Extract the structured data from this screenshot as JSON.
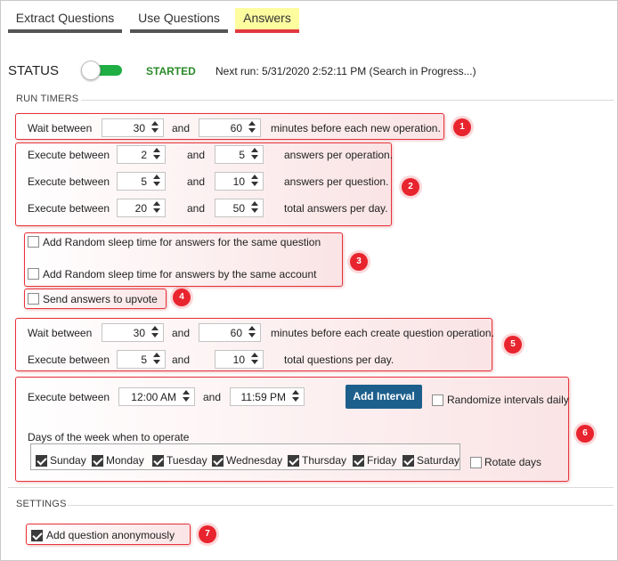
{
  "tabs": [
    {
      "label": "Extract Questions"
    },
    {
      "label": "Use Questions"
    },
    {
      "label": "Answers",
      "active": true
    }
  ],
  "status": {
    "label": "STATUS",
    "toggle_on": true,
    "state": "STARTED",
    "next_run": "Next run: 5/31/2020 2:52:11 PM (Search in Progress...)"
  },
  "run_timers": {
    "title": "RUN TIMERS",
    "wait": {
      "prefix": "Wait between",
      "min": "30",
      "and": "and",
      "max": "60",
      "suffix": "minutes before each new operation."
    },
    "rows": [
      {
        "prefix": "Execute between",
        "min": "2",
        "and": "and",
        "max": "5",
        "suffix": "answers per operation."
      },
      {
        "prefix": "Execute between",
        "min": "5",
        "and": "and",
        "max": "10",
        "suffix": "answers per question."
      },
      {
        "prefix": "Execute between",
        "min": "20",
        "and": "and",
        "max": "50",
        "suffix": "total answers per day."
      }
    ],
    "checkboxes": [
      {
        "label": "Add Random sleep time for answers for the same question",
        "checked": false
      },
      {
        "label": "Add Random sleep time for answers by the same account",
        "checked": false
      },
      {
        "label": "Send answers to upvote",
        "checked": false
      }
    ],
    "question_wait": {
      "prefix": "Wait between",
      "min": "30",
      "and": "and",
      "max": "60",
      "suffix": "minutes before each create question operation."
    },
    "question_exec": {
      "prefix": "Execute between",
      "min": "5",
      "and": "and",
      "max": "10",
      "suffix": "total questions per day."
    },
    "interval": {
      "prefix": "Execute between",
      "start": "12:00 AM",
      "and": "and",
      "end": "11:59 PM",
      "add_button": "Add Interval",
      "randomize_label": "Randomize intervals daily",
      "randomize_checked": false
    },
    "days": {
      "title": "Days of the week when to operate",
      "items": [
        {
          "label": "Sunday",
          "checked": true
        },
        {
          "label": "Monday",
          "checked": true
        },
        {
          "label": "Tuesday",
          "checked": true
        },
        {
          "label": "Wednesday",
          "checked": true
        },
        {
          "label": "Thursday",
          "checked": true
        },
        {
          "label": "Friday",
          "checked": true
        },
        {
          "label": "Saturday",
          "checked": true
        }
      ],
      "rotate_label": "Rotate days",
      "rotate_checked": false
    }
  },
  "settings": {
    "title": "SETTINGS",
    "anonymous_label": "Add question anonymously",
    "anonymous_checked": true
  },
  "badges": [
    "1",
    "2",
    "3",
    "4",
    "5",
    "6",
    "7"
  ],
  "colors": {
    "accent_red": "#e8323a",
    "toggle_green": "#1fae44",
    "started_green": "#2a8a2a",
    "button_blue": "#1d5f8c",
    "active_tab_bg": "#fdfda0"
  }
}
